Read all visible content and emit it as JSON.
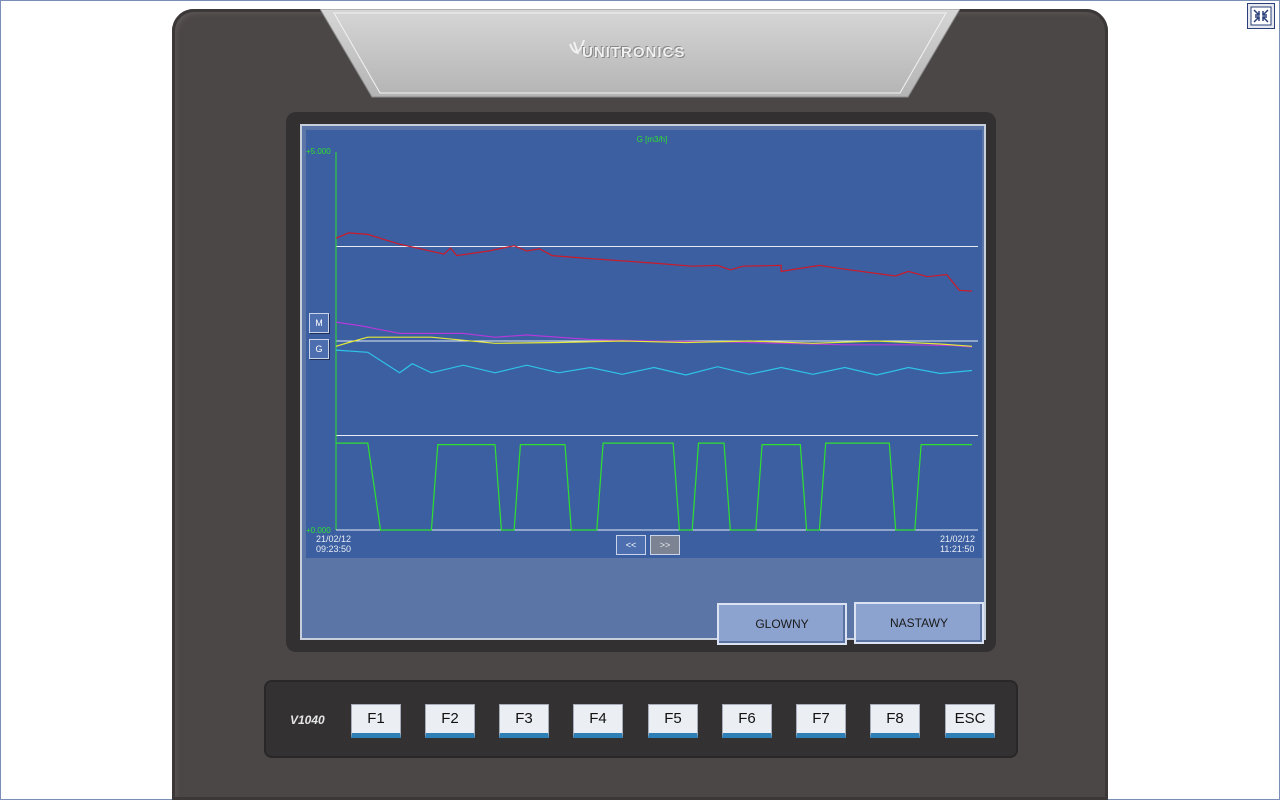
{
  "window": {
    "restore_icon": "restore-window-icon"
  },
  "device": {
    "brand": "UNITRONICS",
    "model": "V1040"
  },
  "chart_data": {
    "type": "line",
    "title": "G [m3/h]",
    "y_axis": {
      "max_label": "+5.000",
      "min_label": "+0.000",
      "ylim": [
        0,
        5
      ]
    },
    "x_axis": {
      "start_date": "21/02/12",
      "start_time": "09:23:50",
      "end_date": "21/02/12",
      "end_time": "11:21:50"
    },
    "grid": "horizontal",
    "colors": {
      "red": "#cc1a2a",
      "magenta": "#b23ad8",
      "yellow": "#e4e83a",
      "cyan": "#2fc3e8",
      "green": "#30e030"
    },
    "series": [
      {
        "color": "red",
        "points": [
          [
            0,
            3.86
          ],
          [
            0.02,
            3.93
          ],
          [
            0.05,
            3.91
          ],
          [
            0.1,
            3.78
          ],
          [
            0.17,
            3.65
          ],
          [
            0.18,
            3.73
          ],
          [
            0.19,
            3.63
          ],
          [
            0.24,
            3.69
          ],
          [
            0.28,
            3.76
          ],
          [
            0.3,
            3.69
          ],
          [
            0.32,
            3.72
          ],
          [
            0.34,
            3.63
          ],
          [
            0.4,
            3.59
          ],
          [
            0.5,
            3.53
          ],
          [
            0.56,
            3.49
          ],
          [
            0.6,
            3.5
          ],
          [
            0.62,
            3.44
          ],
          [
            0.64,
            3.49
          ],
          [
            0.7,
            3.5
          ],
          [
            0.7,
            3.42
          ],
          [
            0.76,
            3.5
          ],
          [
            0.8,
            3.45
          ],
          [
            0.88,
            3.36
          ],
          [
            0.9,
            3.42
          ],
          [
            0.93,
            3.35
          ],
          [
            0.96,
            3.38
          ],
          [
            0.98,
            3.17
          ],
          [
            1.0,
            3.16
          ]
        ]
      },
      {
        "color": "magenta",
        "points": [
          [
            0,
            2.75
          ],
          [
            0.04,
            2.7
          ],
          [
            0.1,
            2.6
          ],
          [
            0.2,
            2.6
          ],
          [
            0.25,
            2.55
          ],
          [
            0.3,
            2.58
          ],
          [
            0.4,
            2.52
          ],
          [
            0.5,
            2.5
          ],
          [
            0.6,
            2.49
          ],
          [
            0.7,
            2.47
          ],
          [
            0.8,
            2.45
          ],
          [
            0.9,
            2.45
          ],
          [
            0.97,
            2.44
          ],
          [
            1.0,
            2.42
          ]
        ]
      },
      {
        "color": "yellow",
        "points": [
          [
            0,
            2.43
          ],
          [
            0.02,
            2.48
          ],
          [
            0.05,
            2.55
          ],
          [
            0.15,
            2.55
          ],
          [
            0.25,
            2.47
          ],
          [
            0.35,
            2.48
          ],
          [
            0.45,
            2.5
          ],
          [
            0.55,
            2.48
          ],
          [
            0.65,
            2.5
          ],
          [
            0.75,
            2.47
          ],
          [
            0.85,
            2.5
          ],
          [
            0.95,
            2.46
          ],
          [
            1.0,
            2.43
          ]
        ]
      },
      {
        "color": "cyan",
        "points": [
          [
            0,
            2.38
          ],
          [
            0.05,
            2.35
          ],
          [
            0.1,
            2.08
          ],
          [
            0.12,
            2.2
          ],
          [
            0.15,
            2.08
          ],
          [
            0.2,
            2.18
          ],
          [
            0.25,
            2.08
          ],
          [
            0.3,
            2.18
          ],
          [
            0.35,
            2.08
          ],
          [
            0.4,
            2.15
          ],
          [
            0.45,
            2.06
          ],
          [
            0.5,
            2.15
          ],
          [
            0.55,
            2.05
          ],
          [
            0.6,
            2.16
          ],
          [
            0.65,
            2.06
          ],
          [
            0.7,
            2.15
          ],
          [
            0.75,
            2.06
          ],
          [
            0.8,
            2.15
          ],
          [
            0.85,
            2.05
          ],
          [
            0.9,
            2.15
          ],
          [
            0.95,
            2.07
          ],
          [
            1.0,
            2.11
          ]
        ]
      },
      {
        "color": "green",
        "points": [
          [
            0,
            1.15
          ],
          [
            0.05,
            1.15
          ],
          [
            0.07,
            0
          ],
          [
            0.15,
            0
          ],
          [
            0.16,
            1.13
          ],
          [
            0.25,
            1.13
          ],
          [
            0.26,
            0
          ],
          [
            0.28,
            0
          ],
          [
            0.29,
            1.13
          ],
          [
            0.36,
            1.13
          ],
          [
            0.37,
            0
          ],
          [
            0.41,
            0
          ],
          [
            0.42,
            1.15
          ],
          [
            0.53,
            1.15
          ],
          [
            0.54,
            0
          ],
          [
            0.56,
            0
          ],
          [
            0.57,
            1.15
          ],
          [
            0.61,
            1.15
          ],
          [
            0.62,
            0
          ],
          [
            0.66,
            0
          ],
          [
            0.67,
            1.13
          ],
          [
            0.73,
            1.13
          ],
          [
            0.74,
            0
          ],
          [
            0.76,
            0
          ],
          [
            0.77,
            1.15
          ],
          [
            0.87,
            1.15
          ],
          [
            0.88,
            0
          ],
          [
            0.91,
            0
          ],
          [
            0.92,
            1.13
          ],
          [
            1.0,
            1.13
          ]
        ]
      }
    ]
  },
  "side_buttons": {
    "m": "M",
    "g": "G"
  },
  "nav": {
    "prev": "<<",
    "next": ">>"
  },
  "screen_buttons": {
    "glowny": "GLOWNY",
    "nastawy": "NASTAWY"
  },
  "keys": [
    "F1",
    "F2",
    "F3",
    "F4",
    "F5",
    "F6",
    "F7",
    "F8",
    "ESC"
  ]
}
